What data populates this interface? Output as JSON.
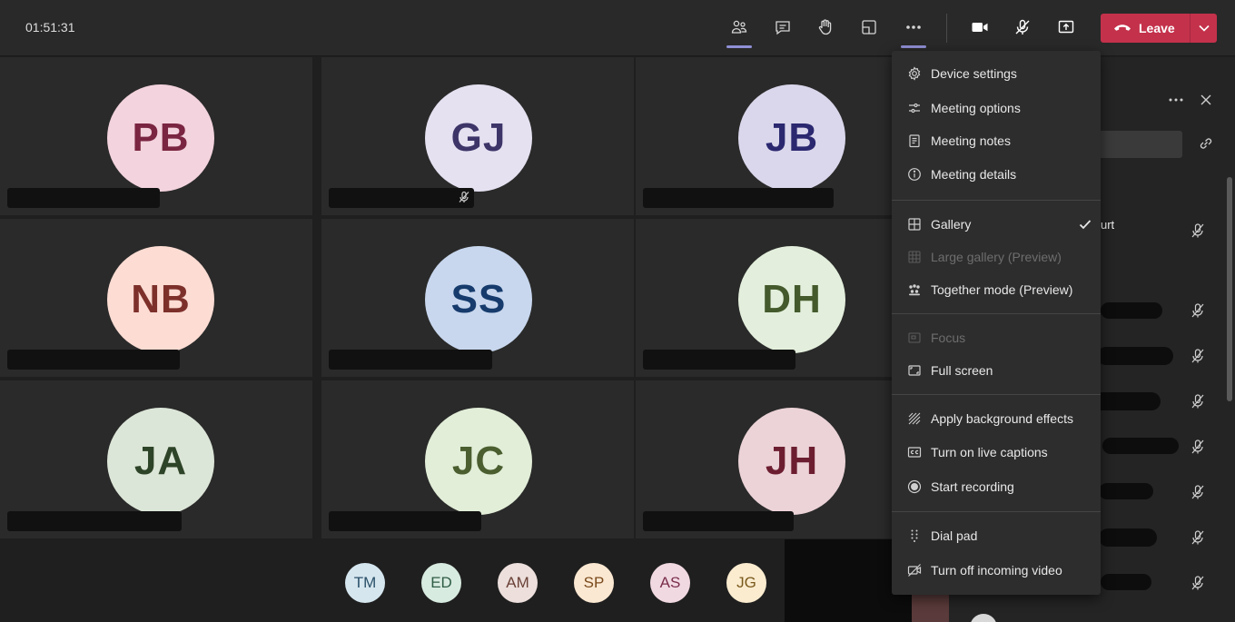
{
  "meeting": {
    "timer": "01:51:31",
    "leave_label": "Leave"
  },
  "tiles": [
    {
      "initials": "PB",
      "bg": "#f3d3dd",
      "fg": "#7a2541"
    },
    {
      "initials": "GJ",
      "bg": "#e5e1f1",
      "fg": "#3d3568"
    },
    {
      "initials": "JB",
      "bg": "#dad7ec",
      "fg": "#2b2870"
    },
    {
      "initials": "NB",
      "bg": "#fcdcd3",
      "fg": "#7d302a"
    },
    {
      "initials": "SS",
      "bg": "#c8d7ee",
      "fg": "#163b6c"
    },
    {
      "initials": "DH",
      "bg": "#e3efdc",
      "fg": "#445a2c"
    },
    {
      "initials": "JA",
      "bg": "#dce6d8",
      "fg": "#2e4428"
    },
    {
      "initials": "JC",
      "bg": "#e2eed8",
      "fg": "#4a5e2f"
    },
    {
      "initials": "JH",
      "bg": "#ecd3d8",
      "fg": "#6c1e30"
    }
  ],
  "overflow": [
    {
      "initials": "TM",
      "bg": "#d5e6ef",
      "fg": "#2a5068"
    },
    {
      "initials": "ED",
      "bg": "#d8ebe1",
      "fg": "#2f5d45"
    },
    {
      "initials": "AM",
      "bg": "#ecdfdc",
      "fg": "#6a4137"
    },
    {
      "initials": "SP",
      "bg": "#fbe8d2",
      "fg": "#7a4a1c"
    },
    {
      "initials": "AS",
      "bg": "#f1d9e2",
      "fg": "#7a2e4b"
    },
    {
      "initials": "JG",
      "bg": "#fbecd0",
      "fg": "#7a5a1c"
    }
  ],
  "pane": {
    "name_fragment": "urt"
  },
  "menu": {
    "device_settings": "Device settings",
    "meeting_options": "Meeting options",
    "meeting_notes": "Meeting notes",
    "meeting_details": "Meeting details",
    "gallery": "Gallery",
    "large_gallery": "Large gallery (Preview)",
    "together_mode": "Together mode (Preview)",
    "focus": "Focus",
    "full_screen": "Full screen",
    "background_effects": "Apply background effects",
    "live_captions": "Turn on live captions",
    "start_recording": "Start recording",
    "dial_pad": "Dial pad",
    "turn_off_video": "Turn off incoming video"
  },
  "colors": {
    "leave": "#c4314b",
    "accent": "#8f8fd6"
  }
}
